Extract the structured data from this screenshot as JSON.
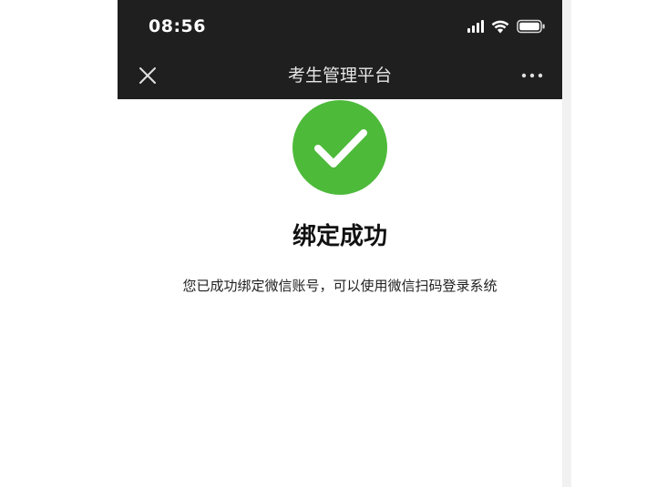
{
  "status_bar": {
    "time": "08:56",
    "icons": [
      "signal-icon",
      "wifi-icon",
      "battery-icon"
    ]
  },
  "nav_bar": {
    "close_icon": "close-icon",
    "title": "考生管理平台",
    "more_icon": "more-icon"
  },
  "result": {
    "icon": "checkmark-icon",
    "icon_color": "#4dba3a",
    "title": "绑定成功",
    "description": "您已成功绑定微信账号，可以使用微信扫码登录系统"
  },
  "colors": {
    "bar_background": "#1f1f1f",
    "page_background": "#ffffff"
  }
}
